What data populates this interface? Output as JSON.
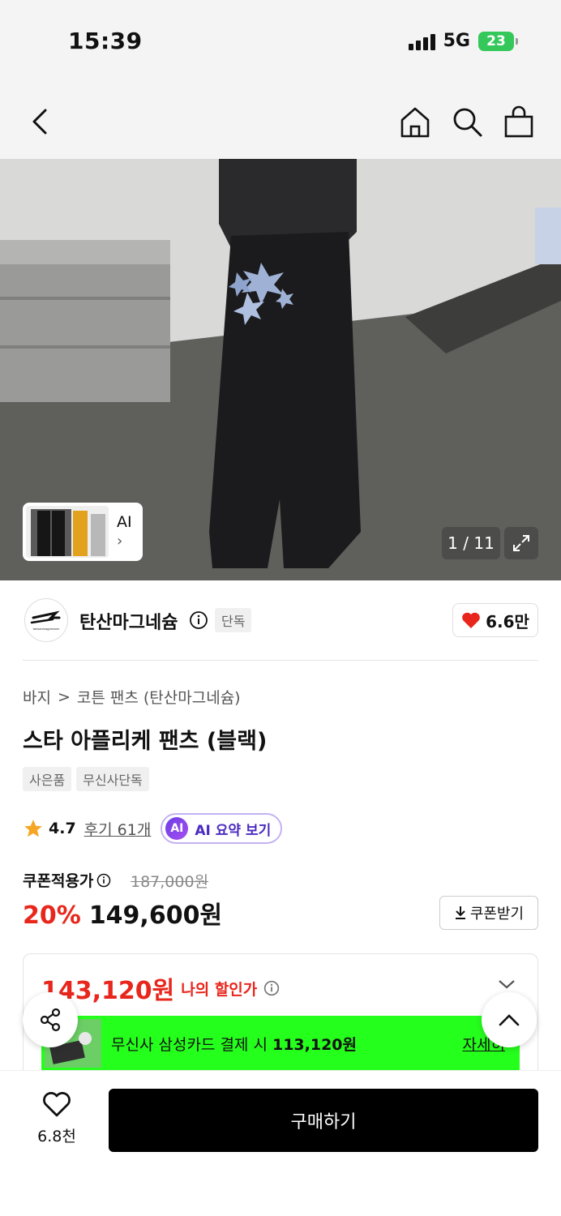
{
  "status_bar": {
    "time": "15:39",
    "network": "5G",
    "battery": "23"
  },
  "nav": {
    "icons": [
      "back-icon",
      "home-icon",
      "search-icon",
      "bag-icon"
    ]
  },
  "hero": {
    "counter": "1 / 11",
    "ai_card_label": "AI",
    "ai_card_chevron": "›"
  },
  "brand": {
    "name": "탄산마그네슘",
    "tag": "단독",
    "likes": "6.6만",
    "logo_text": "tansanmagnesium"
  },
  "product": {
    "breadcrumb": [
      "바지",
      "코튼 팬츠 (탄산마그네슘)"
    ],
    "breadcrumb_sep": ">",
    "title": "스타 아플리케 팬츠 (블랙)",
    "tags": [
      "사은품",
      "무신사단독"
    ],
    "rating": "4.7",
    "reviews": "후기 61개",
    "ai_badge": "AI",
    "ai_summary": "AI 요약 보기"
  },
  "price": {
    "coupon_label": "쿠폰적용가",
    "original": "187,000원",
    "discount": "20%",
    "current": "149,600원",
    "coupon_button": "쿠폰받기"
  },
  "benefit": {
    "my_price": "143,120원",
    "my_price_label": "나의 할인가",
    "banner_text_prefix": "무신사 삼성카드 결제 시 ",
    "banner_text_amount": "113,120원",
    "banner_link": "자세히"
  },
  "bottom": {
    "like_count": "6.8천",
    "buy_label": "구매하기"
  },
  "colors": {
    "accent_red": "#e8261c",
    "banner_green": "#25ff1c",
    "ai_purple": "#6b3fe6"
  }
}
